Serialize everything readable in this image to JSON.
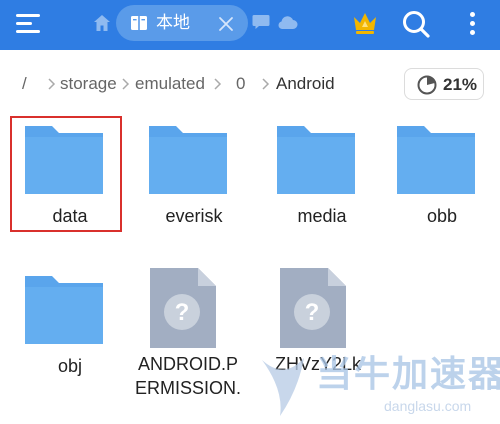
{
  "topbar": {
    "tab_label": "本地",
    "colors": {
      "bar": "#2f7de3",
      "tab": "#5a9be9",
      "crown": "#f2b600"
    },
    "icons": [
      "menu-icon",
      "home-icon",
      "book-icon",
      "close-icon",
      "chat-icon",
      "cloud-icon",
      "crown-icon",
      "search-icon",
      "more-vertical-icon"
    ]
  },
  "breadcrumb": {
    "items": [
      "/",
      "storage",
      "emulated",
      "0",
      "Android"
    ],
    "storage_usage": "21%",
    "storage_fraction": 0.21
  },
  "files": [
    {
      "name": "data",
      "type": "folder",
      "selected": true
    },
    {
      "name": "everisk",
      "type": "folder"
    },
    {
      "name": "media",
      "type": "folder"
    },
    {
      "name": "obb",
      "type": "folder"
    },
    {
      "name": "obj",
      "type": "folder"
    },
    {
      "name": "ANDROID.P\nERMISSION.",
      "type": "unknown-file"
    },
    {
      "name": "ZHVzY2Lk",
      "type": "unknown-file"
    }
  ],
  "watermark": {
    "text": "当牛加速器",
    "sub": "danglasu.com"
  }
}
